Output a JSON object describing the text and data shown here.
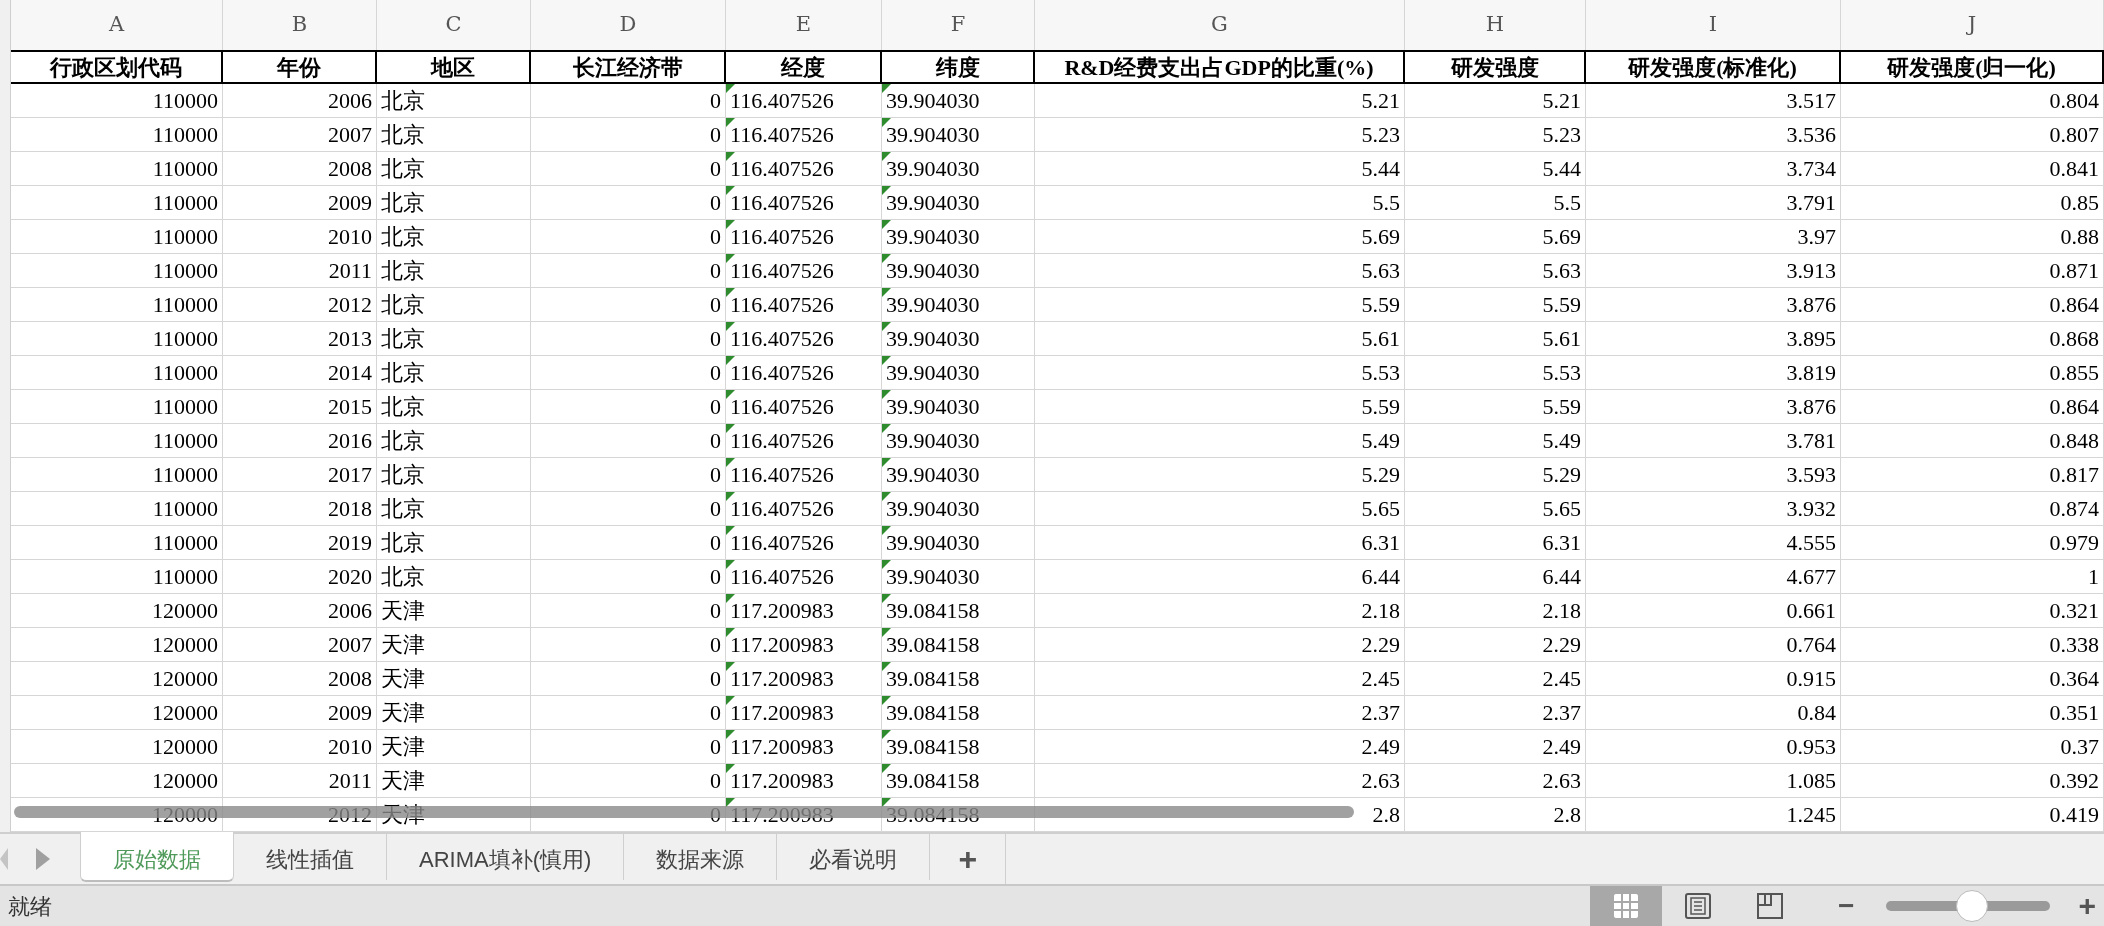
{
  "columns": [
    {
      "letter": "A",
      "header": "行政区划代码",
      "kind": "number"
    },
    {
      "letter": "B",
      "header": "年份",
      "kind": "number"
    },
    {
      "letter": "C",
      "header": "地区",
      "kind": "text"
    },
    {
      "letter": "D",
      "header": "长江经济带",
      "kind": "number"
    },
    {
      "letter": "E",
      "header": "经度",
      "kind": "text_number"
    },
    {
      "letter": "F",
      "header": "纬度",
      "kind": "text_number"
    },
    {
      "letter": "G",
      "header": "R&D经费支出占GDP的比重(%)",
      "kind": "number"
    },
    {
      "letter": "H",
      "header": "研发强度",
      "kind": "number"
    },
    {
      "letter": "I",
      "header": "研发强度(标准化)",
      "kind": "number"
    },
    {
      "letter": "J",
      "header": "研发强度(归一化)",
      "kind": "number"
    }
  ],
  "rows": [
    [
      "110000",
      "2006",
      "北京",
      "0",
      "116.407526",
      "39.904030",
      "5.21",
      "5.21",
      "3.517",
      "0.804"
    ],
    [
      "110000",
      "2007",
      "北京",
      "0",
      "116.407526",
      "39.904030",
      "5.23",
      "5.23",
      "3.536",
      "0.807"
    ],
    [
      "110000",
      "2008",
      "北京",
      "0",
      "116.407526",
      "39.904030",
      "5.44",
      "5.44",
      "3.734",
      "0.841"
    ],
    [
      "110000",
      "2009",
      "北京",
      "0",
      "116.407526",
      "39.904030",
      "5.5",
      "5.5",
      "3.791",
      "0.85"
    ],
    [
      "110000",
      "2010",
      "北京",
      "0",
      "116.407526",
      "39.904030",
      "5.69",
      "5.69",
      "3.97",
      "0.88"
    ],
    [
      "110000",
      "2011",
      "北京",
      "0",
      "116.407526",
      "39.904030",
      "5.63",
      "5.63",
      "3.913",
      "0.871"
    ],
    [
      "110000",
      "2012",
      "北京",
      "0",
      "116.407526",
      "39.904030",
      "5.59",
      "5.59",
      "3.876",
      "0.864"
    ],
    [
      "110000",
      "2013",
      "北京",
      "0",
      "116.407526",
      "39.904030",
      "5.61",
      "5.61",
      "3.895",
      "0.868"
    ],
    [
      "110000",
      "2014",
      "北京",
      "0",
      "116.407526",
      "39.904030",
      "5.53",
      "5.53",
      "3.819",
      "0.855"
    ],
    [
      "110000",
      "2015",
      "北京",
      "0",
      "116.407526",
      "39.904030",
      "5.59",
      "5.59",
      "3.876",
      "0.864"
    ],
    [
      "110000",
      "2016",
      "北京",
      "0",
      "116.407526",
      "39.904030",
      "5.49",
      "5.49",
      "3.781",
      "0.848"
    ],
    [
      "110000",
      "2017",
      "北京",
      "0",
      "116.407526",
      "39.904030",
      "5.29",
      "5.29",
      "3.593",
      "0.817"
    ],
    [
      "110000",
      "2018",
      "北京",
      "0",
      "116.407526",
      "39.904030",
      "5.65",
      "5.65",
      "3.932",
      "0.874"
    ],
    [
      "110000",
      "2019",
      "北京",
      "0",
      "116.407526",
      "39.904030",
      "6.31",
      "6.31",
      "4.555",
      "0.979"
    ],
    [
      "110000",
      "2020",
      "北京",
      "0",
      "116.407526",
      "39.904030",
      "6.44",
      "6.44",
      "4.677",
      "1"
    ],
    [
      "120000",
      "2006",
      "天津",
      "0",
      "117.200983",
      "39.084158",
      "2.18",
      "2.18",
      "0.661",
      "0.321"
    ],
    [
      "120000",
      "2007",
      "天津",
      "0",
      "117.200983",
      "39.084158",
      "2.29",
      "2.29",
      "0.764",
      "0.338"
    ],
    [
      "120000",
      "2008",
      "天津",
      "0",
      "117.200983",
      "39.084158",
      "2.45",
      "2.45",
      "0.915",
      "0.364"
    ],
    [
      "120000",
      "2009",
      "天津",
      "0",
      "117.200983",
      "39.084158",
      "2.37",
      "2.37",
      "0.84",
      "0.351"
    ],
    [
      "120000",
      "2010",
      "天津",
      "0",
      "117.200983",
      "39.084158",
      "2.49",
      "2.49",
      "0.953",
      "0.37"
    ],
    [
      "120000",
      "2011",
      "天津",
      "0",
      "117.200983",
      "39.084158",
      "2.63",
      "2.63",
      "1.085",
      "0.392"
    ],
    [
      "120000",
      "2012",
      "天津",
      "0",
      "117.200983",
      "39.084158",
      "2.8",
      "2.8",
      "1.245",
      "0.419"
    ]
  ],
  "sheet_tabs": [
    {
      "label": "原始数据",
      "selected": true
    },
    {
      "label": "线性插值",
      "selected": false
    },
    {
      "label": "ARIMA填补(慎用)",
      "selected": false
    },
    {
      "label": "数据来源",
      "selected": false
    },
    {
      "label": "必看说明",
      "selected": false
    }
  ],
  "add_sheet": "+",
  "status_bar": {
    "text": "就绪",
    "views": [
      {
        "kind": "normal",
        "selected": true
      },
      {
        "kind": "page_layout",
        "selected": false
      },
      {
        "kind": "page_break",
        "selected": false
      }
    ],
    "zoom": {
      "minus": "−",
      "plus": "+",
      "level": 0.52
    }
  }
}
